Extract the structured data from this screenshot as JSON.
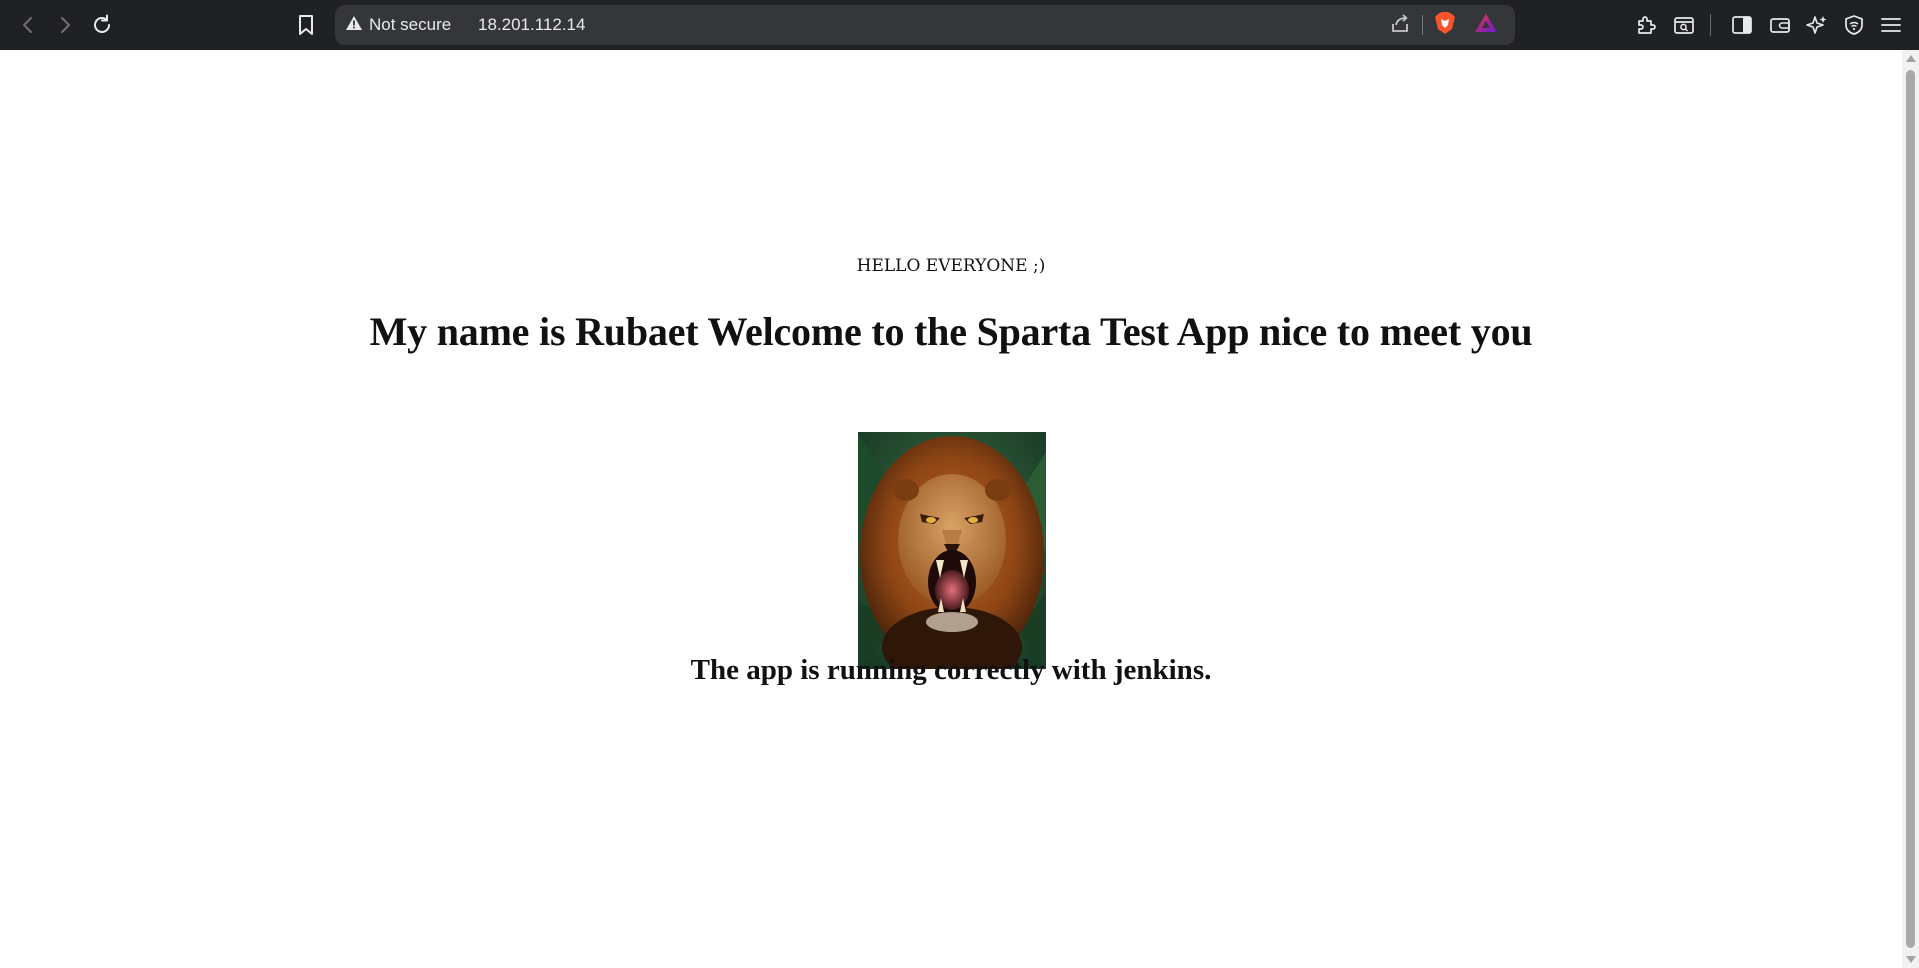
{
  "browser": {
    "security_label": "Not secure",
    "url": "18.201.112.14",
    "icons": [
      "back-icon",
      "forward-icon",
      "reload-icon",
      "bookmark-icon",
      "warning-icon",
      "share-icon",
      "brave-shields-icon",
      "brave-rewards-icon",
      "extensions-icon",
      "search-tab-icon",
      "sidebar-icon",
      "wallet-icon",
      "leo-ai-icon",
      "vpn-icon",
      "menu-icon"
    ]
  },
  "page": {
    "greeting": "HELLO EVERYONE ;)",
    "headline": "My name is Rubaet Welcome to the Sparta Test App nice to meet you",
    "status": "The app is running correctly with jenkins."
  }
}
